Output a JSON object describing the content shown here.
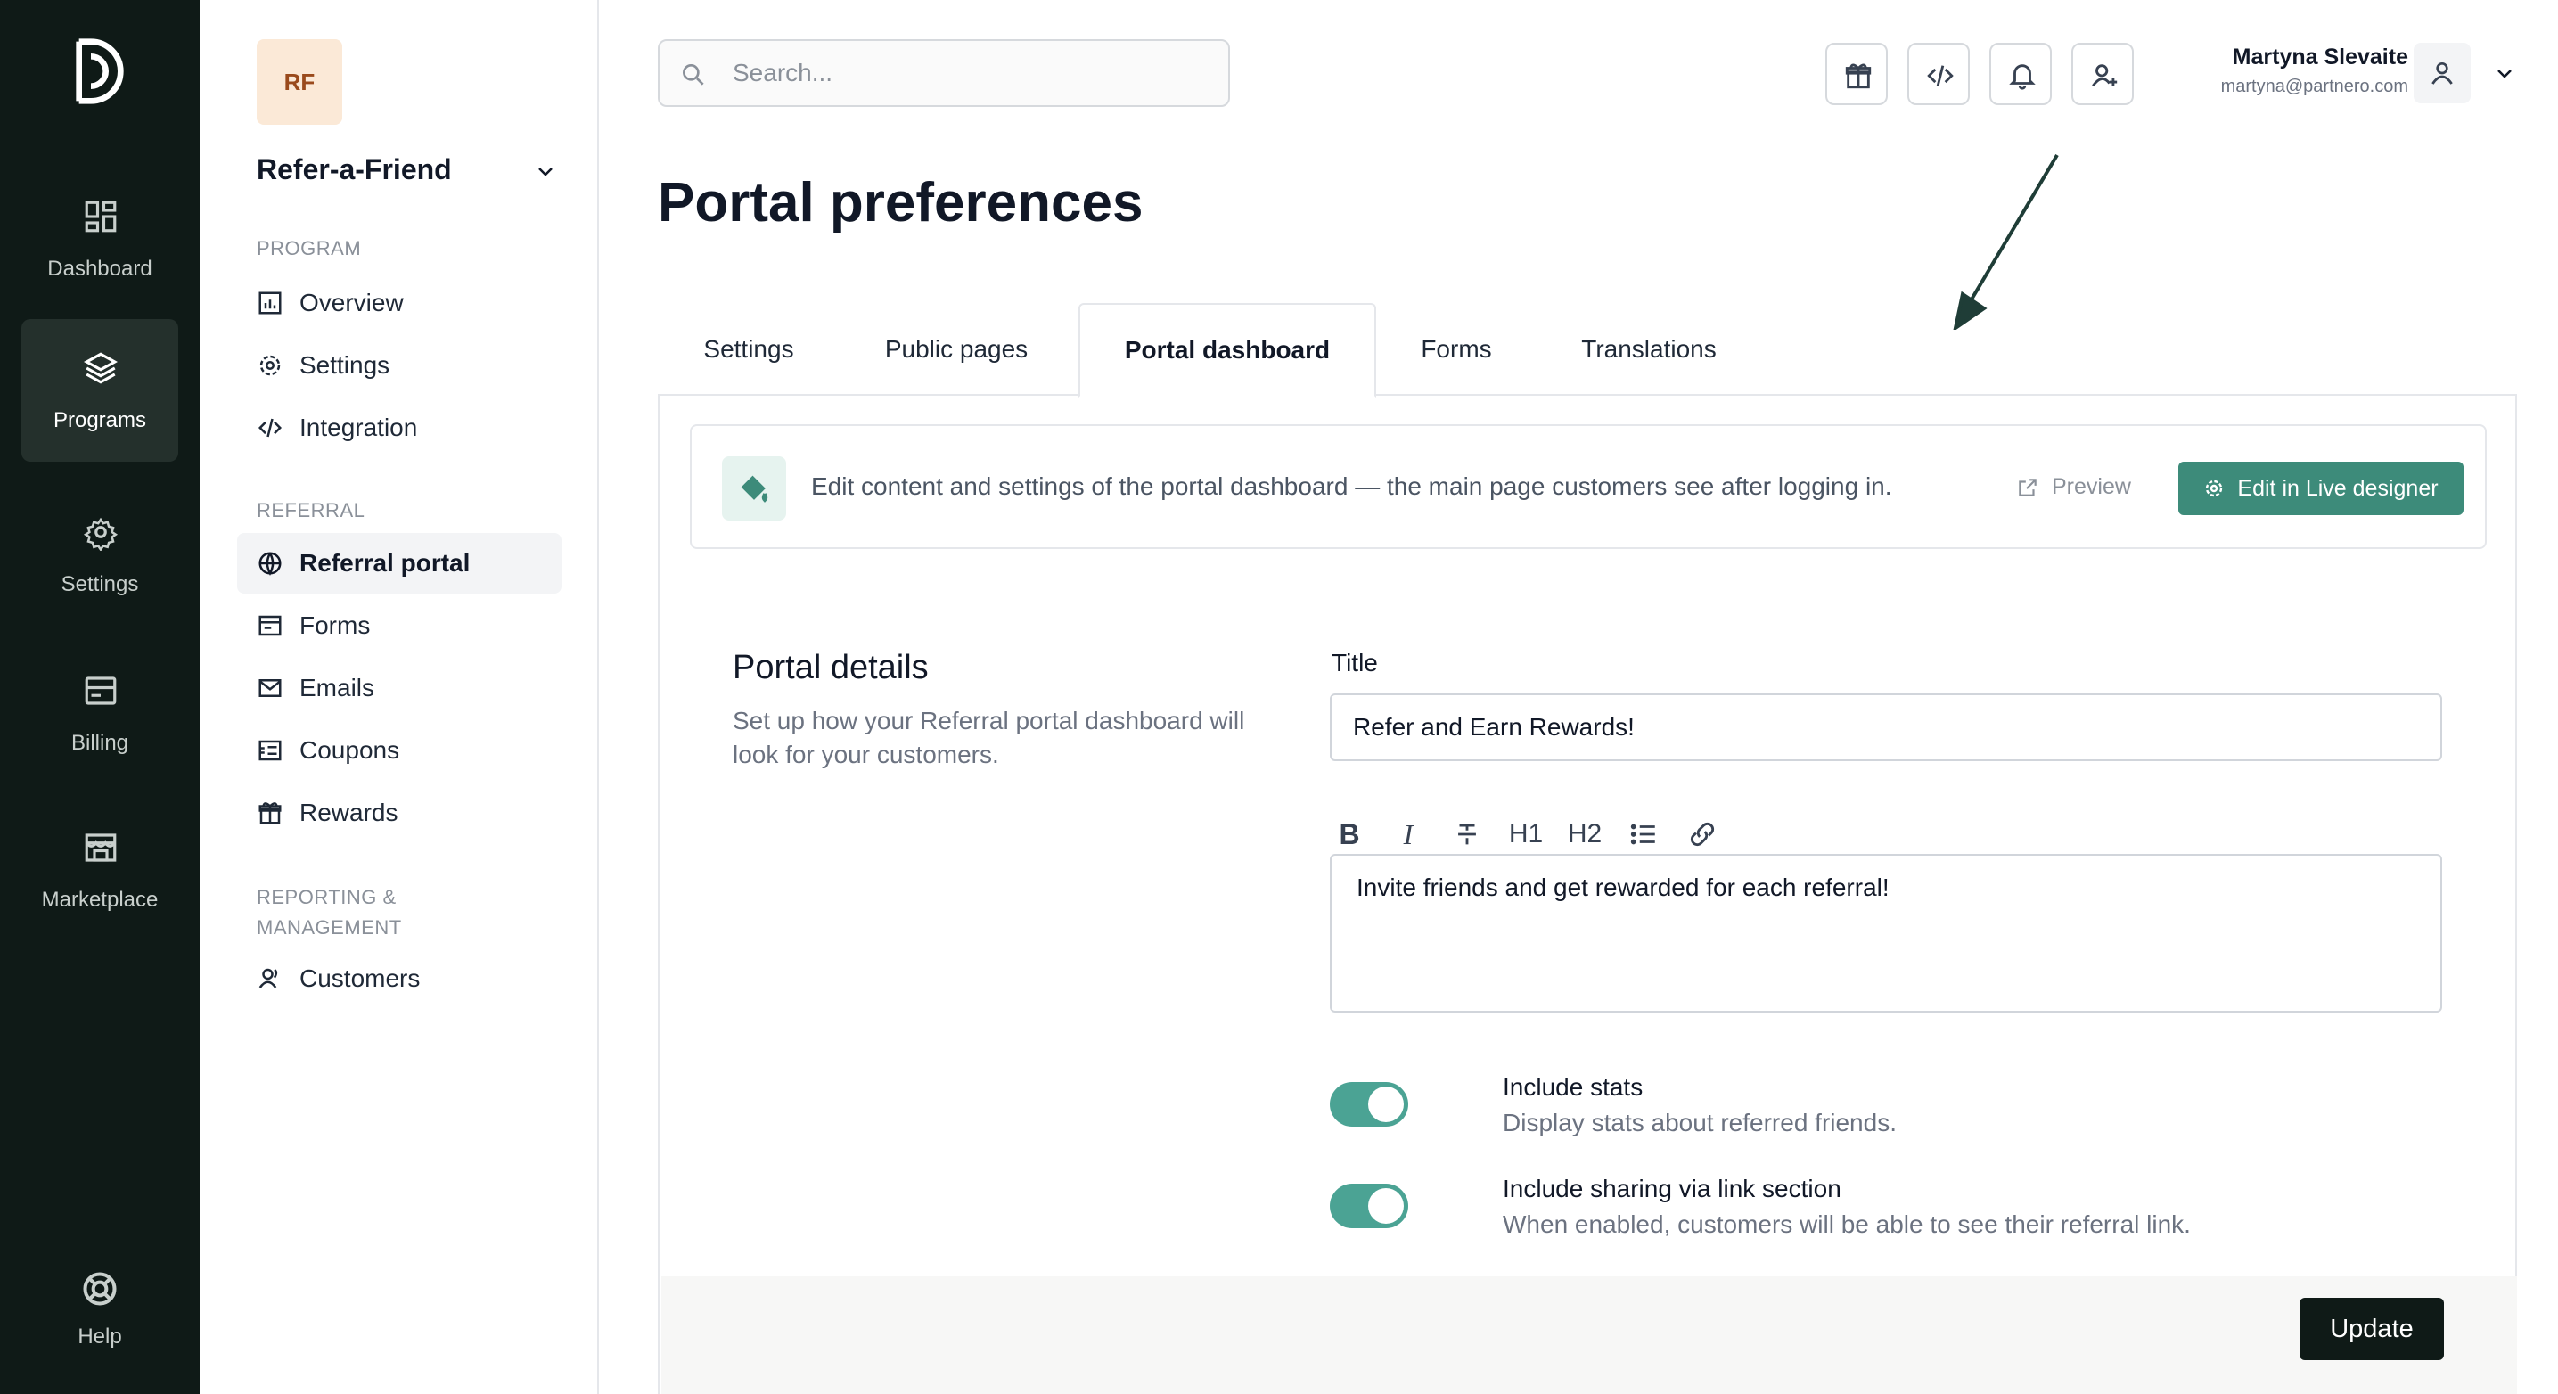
{
  "rail": {
    "items": [
      {
        "label": "Dashboard",
        "icon": "dashboard-icon"
      },
      {
        "label": "Programs",
        "icon": "layers-icon"
      },
      {
        "label": "Settings",
        "icon": "gear-icon"
      },
      {
        "label": "Billing",
        "icon": "billing-icon"
      },
      {
        "label": "Marketplace",
        "icon": "store-icon"
      }
    ],
    "help_label": "Help"
  },
  "program": {
    "initials": "RF",
    "name": "Refer-a-Friend"
  },
  "nav": {
    "program_section": "PROGRAM",
    "program_items": [
      {
        "label": "Overview",
        "icon": "chart-icon"
      },
      {
        "label": "Settings",
        "icon": "gear-icon"
      },
      {
        "label": "Integration",
        "icon": "code-icon"
      }
    ],
    "referral_section": "REFERRAL",
    "referral_items": [
      {
        "label": "Referral portal",
        "icon": "globe-icon"
      },
      {
        "label": "Forms",
        "icon": "form-icon"
      },
      {
        "label": "Emails",
        "icon": "email-icon"
      },
      {
        "label": "Coupons",
        "icon": "coupon-icon"
      },
      {
        "label": "Rewards",
        "icon": "gift-icon"
      }
    ],
    "reporting_section_line1": "REPORTING &",
    "reporting_section_line2": "MANAGEMENT",
    "reporting_items": [
      {
        "label": "Customers",
        "icon": "users-icon"
      }
    ]
  },
  "header": {
    "search_placeholder": "Search...",
    "user_name": "Martyna Slevaite",
    "user_email": "martyna@partnero.com"
  },
  "page": {
    "title": "Portal preferences",
    "tabs": [
      {
        "label": "Settings"
      },
      {
        "label": "Public pages"
      },
      {
        "label": "Portal dashboard"
      },
      {
        "label": "Forms"
      },
      {
        "label": "Translations"
      }
    ],
    "active_tab": "Portal dashboard"
  },
  "info": {
    "text": "Edit content and settings of the portal dashboard — the main page customers see after logging in.",
    "preview_label": "Preview",
    "live_designer_label": "Edit in Live designer"
  },
  "details": {
    "section_title": "Portal details",
    "section_desc": "Set up how your Referral portal dashboard will look for your customers.",
    "title_label": "Title",
    "title_value": "Refer and Earn Rewards!",
    "toolbar": {
      "bold": "B",
      "italic": "I",
      "h1": "H1",
      "h2": "H2"
    },
    "description_value": "Invite friends and get rewarded for each referral!",
    "options": [
      {
        "title": "Include stats",
        "desc": "Display stats about referred friends.",
        "enabled": true
      },
      {
        "title": "Include sharing via link section",
        "desc": "When enabled, customers will be able to see their referral link.",
        "enabled": true
      }
    ]
  },
  "footer": {
    "update_label": "Update"
  },
  "colors": {
    "rail_bg": "#0f1a17",
    "accent": "#3d8b7a",
    "toggle_on": "#4ba394"
  }
}
